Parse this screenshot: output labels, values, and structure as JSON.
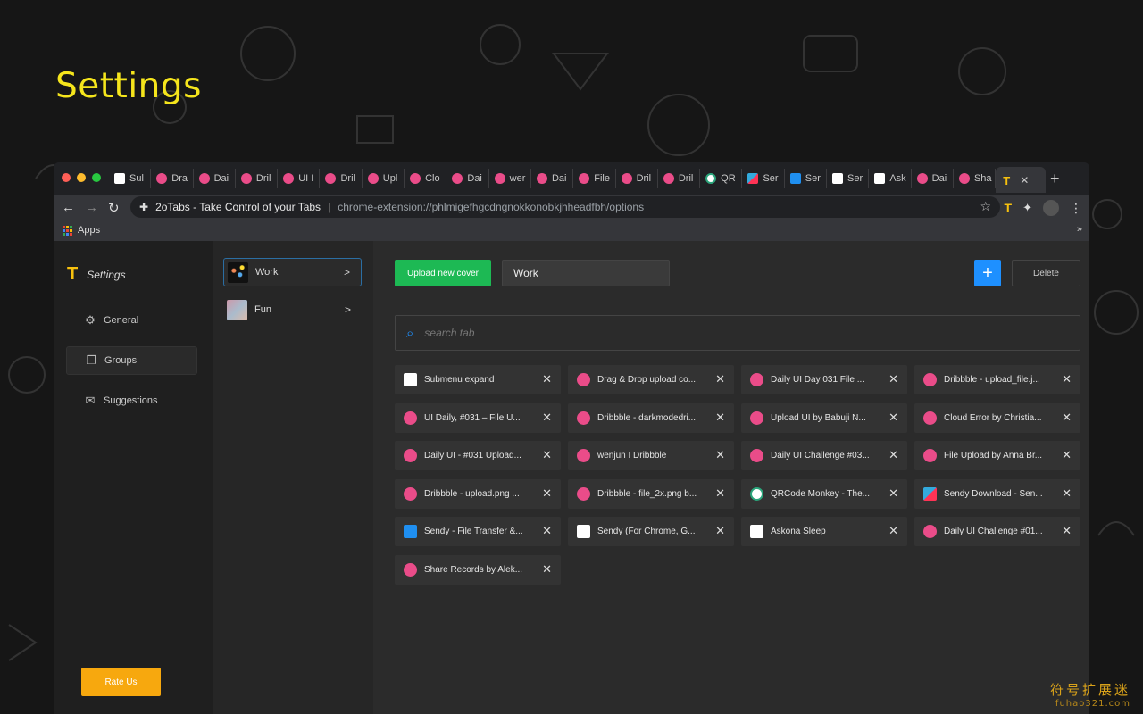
{
  "page": {
    "hero_title": "Settings"
  },
  "watermark": {
    "cn": "符号扩展迷",
    "url": "fuhao321.com"
  },
  "browser": {
    "traffic_colors": [
      "#ff5f57",
      "#febc2e",
      "#28c840"
    ],
    "tabs": [
      {
        "label": "Sul",
        "icon": "sq"
      },
      {
        "label": "Dra",
        "icon": "dribbble"
      },
      {
        "label": "Dai",
        "icon": "dribbble"
      },
      {
        "label": "Dril",
        "icon": "dribbble"
      },
      {
        "label": "UI I",
        "icon": "dribbble"
      },
      {
        "label": "Dril",
        "icon": "dribbble"
      },
      {
        "label": "Upl",
        "icon": "dribbble"
      },
      {
        "label": "Clo",
        "icon": "dribbble"
      },
      {
        "label": "Dai",
        "icon": "dribbble"
      },
      {
        "label": "wer",
        "icon": "dribbble"
      },
      {
        "label": "Dai",
        "icon": "dribbble"
      },
      {
        "label": "File",
        "icon": "dribbble"
      },
      {
        "label": "Dril",
        "icon": "dribbble"
      },
      {
        "label": "Dril",
        "icon": "dribbble"
      },
      {
        "label": "QR",
        "icon": "qr"
      },
      {
        "label": "Ser",
        "icon": "sendy"
      },
      {
        "label": "Ser",
        "icon": "blue"
      },
      {
        "label": "Ser",
        "icon": "sq"
      },
      {
        "label": "Ask",
        "icon": "sq"
      },
      {
        "label": "Dai",
        "icon": "dribbble"
      },
      {
        "label": "Sha",
        "icon": "dribbble"
      }
    ],
    "omnibox": {
      "title": "2oTabs - Take Control of your Tabs",
      "url": "chrome-extension://phlmigefhgcdngnokkonobkjhheadfbh/options"
    },
    "bookmarks": {
      "apps_label": "Apps"
    }
  },
  "sidebar": {
    "brand": "Settings",
    "items": [
      {
        "label": "General",
        "icon": "gear-icon"
      },
      {
        "label": "Groups",
        "icon": "copy-icon"
      },
      {
        "label": "Suggestions",
        "icon": "mail-icon"
      }
    ],
    "rate_label": "Rate Us"
  },
  "groups": [
    {
      "label": "Work"
    },
    {
      "label": "Fun"
    }
  ],
  "main": {
    "cover_btn": "Upload new cover",
    "group_name": "Work",
    "add_btn": "+",
    "delete_btn": "Delete",
    "search_placeholder": "search tab",
    "tabs": [
      {
        "label": "Submenu expand",
        "icon": "sq"
      },
      {
        "label": "Drag & Drop upload co...",
        "icon": "dribbble"
      },
      {
        "label": "Daily UI Day 031 File ...",
        "icon": "dribbble"
      },
      {
        "label": "Dribbble - upload_file.j...",
        "icon": "dribbble"
      },
      {
        "label": "UI Daily, #031 – File U...",
        "icon": "dribbble"
      },
      {
        "label": "Dribbble - darkmodedri...",
        "icon": "dribbble"
      },
      {
        "label": "Upload UI by Babuji N...",
        "icon": "dribbble"
      },
      {
        "label": "Cloud Error by Christia...",
        "icon": "dribbble"
      },
      {
        "label": "Daily UI - #031 Upload...",
        "icon": "dribbble"
      },
      {
        "label": "wenjun I Dribbble",
        "icon": "dribbble"
      },
      {
        "label": "Daily UI Challenge #03...",
        "icon": "dribbble"
      },
      {
        "label": "File Upload by Anna Br...",
        "icon": "dribbble"
      },
      {
        "label": "Dribbble - upload.png ...",
        "icon": "dribbble"
      },
      {
        "label": "Dribbble - file_2x.png b...",
        "icon": "dribbble"
      },
      {
        "label": "QRCode Monkey - The...",
        "icon": "qr"
      },
      {
        "label": "Sendy Download - Sen...",
        "icon": "sendy"
      },
      {
        "label": "Sendy - File Transfer &...",
        "icon": "blue"
      },
      {
        "label": "Sendy (For Chrome, G...",
        "icon": "sq"
      },
      {
        "label": "Askona Sleep",
        "icon": "sq"
      },
      {
        "label": "Daily UI Challenge #01...",
        "icon": "dribbble"
      },
      {
        "label": "Share Records by Alek...",
        "icon": "dribbble"
      }
    ]
  }
}
